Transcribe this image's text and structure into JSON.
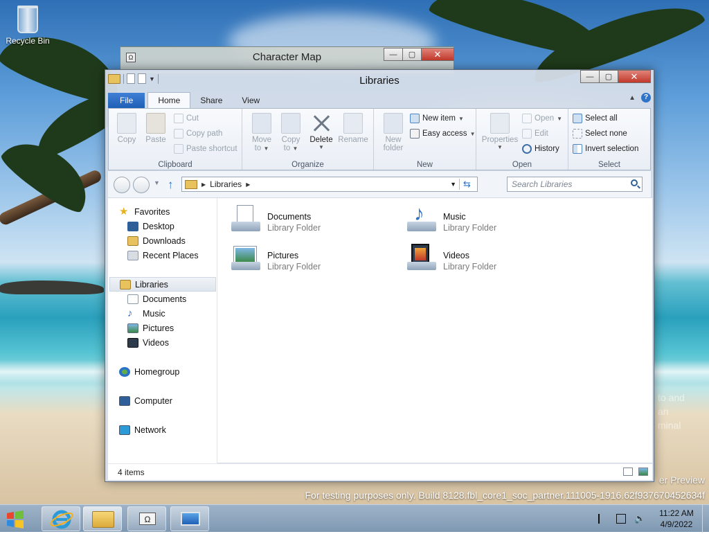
{
  "desktop": {
    "recycle_bin_label": "Recycle Bin",
    "watermark": "For testing purposes only. Build 8128.fbl_core1_soc_partner.111005-1916.62f937670452634f",
    "preview_fragment": "er Preview",
    "ghost_lines": [
      "to and",
      "an",
      "minal"
    ]
  },
  "background_window": {
    "title": "Character Map"
  },
  "window": {
    "title": "Libraries",
    "tabs": {
      "file": "File",
      "home": "Home",
      "share": "Share",
      "view": "View"
    },
    "help": "?",
    "ribbon": {
      "clipboard": {
        "label": "Clipboard",
        "copy": "Copy",
        "paste": "Paste",
        "cut": "Cut",
        "copy_path": "Copy path",
        "paste_shortcut": "Paste shortcut"
      },
      "organize": {
        "label": "Organize",
        "move_to": "Move",
        "move_to_2": "to",
        "copy_to": "Copy",
        "copy_to_2": "to",
        "delete": "Delete",
        "rename": "Rename"
      },
      "new": {
        "label": "New",
        "new_folder": "New",
        "new_folder_2": "folder",
        "new_item": "New item",
        "easy_access": "Easy access"
      },
      "open": {
        "label": "Open",
        "properties": "Properties",
        "open": "Open",
        "edit": "Edit",
        "history": "History"
      },
      "select": {
        "label": "Select",
        "select_all": "Select all",
        "select_none": "Select none",
        "invert_selection": "Invert selection"
      }
    },
    "address": {
      "crumb": "Libraries"
    },
    "search": {
      "placeholder": "Search Libraries"
    },
    "nav": {
      "favorites": "Favorites",
      "desktop": "Desktop",
      "downloads": "Downloads",
      "recent_places": "Recent Places",
      "libraries": "Libraries",
      "documents": "Documents",
      "music": "Music",
      "pictures": "Pictures",
      "videos": "Videos",
      "homegroup": "Homegroup",
      "computer": "Computer",
      "network": "Network"
    },
    "items": [
      {
        "name": "Documents",
        "type": "Library Folder",
        "icon": "documents-library-icon"
      },
      {
        "name": "Music",
        "type": "Library Folder",
        "icon": "music-library-icon"
      },
      {
        "name": "Pictures",
        "type": "Library Folder",
        "icon": "pictures-library-icon"
      },
      {
        "name": "Videos",
        "type": "Library Folder",
        "icon": "videos-library-icon"
      }
    ],
    "status": "4 items"
  },
  "taskbar": {
    "time": "11:22 AM",
    "date": "4/9/2022"
  },
  "colors": {
    "file_tab": "#1f5fb6",
    "accent_blue": "#2b72c9",
    "folder_yellow": "#e8c25d",
    "close_red": "#c1392b"
  }
}
